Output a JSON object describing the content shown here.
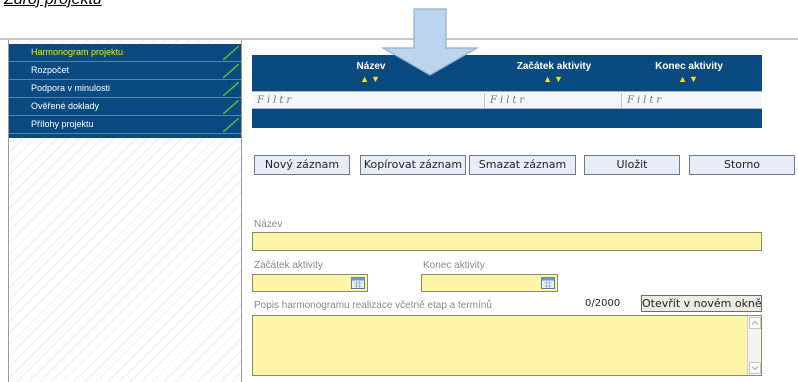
{
  "page_heading": "Zdroj projektu",
  "sidebar": {
    "items": [
      {
        "label": "Harmonogram projektu",
        "active": true
      },
      {
        "label": "Rozpočet",
        "active": false
      },
      {
        "label": "Podpora v minulosti",
        "active": false
      },
      {
        "label": "Ověřené doklady",
        "active": false
      },
      {
        "label": "Přílohy projektu",
        "active": false
      }
    ]
  },
  "grid": {
    "columns": [
      {
        "title": "Název",
        "sort": "▲▼"
      },
      {
        "title": "Začátek aktivity",
        "sort": "▲▼"
      },
      {
        "title": "Konec aktivity",
        "sort": "▲▼"
      }
    ],
    "filter_placeholder": "Filtr"
  },
  "actions": {
    "new": "Nový záznam",
    "copy": "Kopírovat záznam",
    "delete": "Smazat záznam",
    "save": "Uložit",
    "cancel": "Storno"
  },
  "form": {
    "name_label": "Název",
    "start_label": "Začátek aktivity",
    "end_label": "Konec aktivity",
    "description_label": "Popis harmonogramu realizace včetně etap a termínů",
    "char_counter": "0/2000",
    "open_window": "Otevřít v novém okně"
  },
  "colors": {
    "nav_bg": "#0b4a80",
    "active_item": "#f5e21c",
    "field_bg": "#fdf6a8",
    "arrow": "#bcd4ec"
  },
  "icons": [
    "calendar-icon",
    "scroll-up-icon",
    "scroll-down-icon",
    "down-arrow-icon"
  ]
}
